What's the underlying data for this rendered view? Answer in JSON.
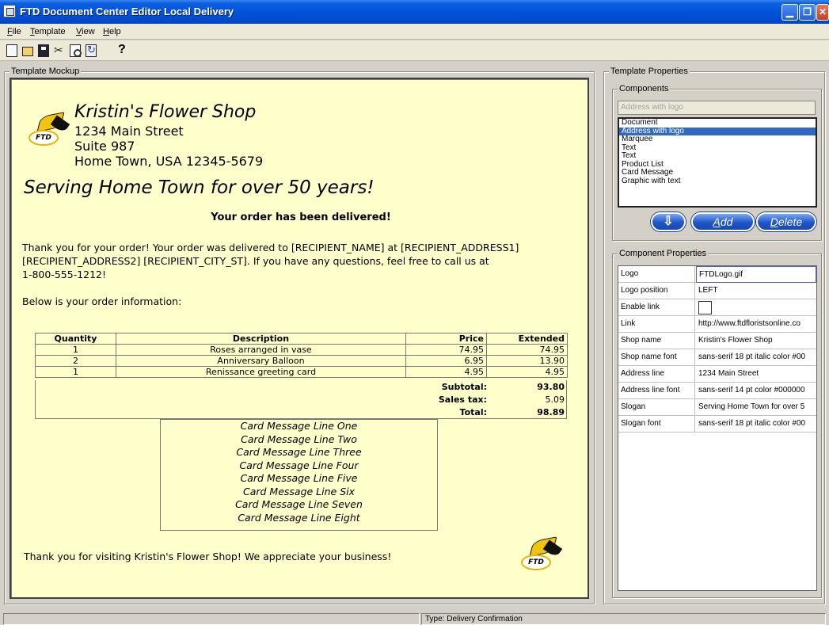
{
  "window": {
    "title": "FTD Document Center Editor  Local Delivery",
    "controls": {
      "minimize": "▁",
      "maximize": "❐",
      "close": "✕"
    }
  },
  "menu": [
    {
      "underline": "F",
      "rest": "ile"
    },
    {
      "underline": "T",
      "rest": "emplate"
    },
    {
      "underline": "V",
      "rest": "iew"
    },
    {
      "underline": "H",
      "rest": "elp"
    }
  ],
  "toolbar": {
    "icons": [
      "new-file-icon",
      "open-folder-icon",
      "save-icon",
      "cut-icon",
      "print-preview-icon",
      "refresh-icon",
      "help-icon"
    ]
  },
  "mockup": {
    "group_label": "Template Mockup",
    "shop_name": "Kristin's Flower Shop",
    "address_lines": [
      "1234 Main Street",
      "Suite 987",
      "Home Town, USA  12345-5679"
    ],
    "slogan": "Serving Home Town for over 50 years!",
    "marquee": "Your order has been delivered!",
    "logo_text": "FTD",
    "paragraph_lines": [
      "Thank you for your order! Your order was delivered to [RECIPIENT_NAME] at [RECIPIENT_ADDRESS1]",
      "[RECIPIENT_ADDRESS2] [RECIPIENT_CITY_ST]. If you have any questions, feel free to call us at",
      "1-800-555-1212!"
    ],
    "order_info_label": "Below is your order information:",
    "table": {
      "headers": [
        "Quantity",
        "Description",
        "Price",
        "Extended"
      ],
      "rows": [
        [
          "1",
          "Roses arranged in vase",
          "74.95",
          "74.95"
        ],
        [
          "2",
          "Anniversary Balloon",
          "6.95",
          "13.90"
        ],
        [
          "1",
          "Renissance greeting card",
          "4.95",
          "4.95"
        ]
      ],
      "subtotal_label": "Subtotal:",
      "subtotal": "93.80",
      "tax_label": "Sales tax:",
      "tax": "5.09",
      "total_label": "Total:",
      "total": "98.89"
    },
    "card_message": [
      "Card Message Line One",
      "Card Message Line Two",
      "Card Message Line Three",
      "Card Message Line Four",
      "Card Message Line Five",
      "Card Message Line Six",
      "Card Message Line Seven",
      "Card Message Line Eight"
    ],
    "closing": "Thank you for visiting Kristin's Flower Shop! We appreciate your business!"
  },
  "properties_panel": {
    "group_label": "Template Properties",
    "components_label": "Components",
    "combo_value": "Address with logo",
    "components": [
      "Document",
      "Address with logo",
      "Marquee",
      "Text",
      "Text",
      "Product List",
      "Card Message",
      "Graphic with text"
    ],
    "selected_index": 1,
    "buttons": {
      "move_down_icon": "⇩",
      "add_u": "A",
      "add_rest": "dd",
      "delete_u": "D",
      "delete_rest": "elete"
    },
    "component_properties_label": "Component Properties",
    "properties": [
      {
        "key": "Logo",
        "value": "FTDLogo.gif"
      },
      {
        "key": "Logo position",
        "value": "LEFT"
      },
      {
        "key": "Enable link",
        "value": ""
      },
      {
        "key": "Link",
        "value": "http://www.ftdfloristsonline.co"
      },
      {
        "key": "Shop name",
        "value": "Kristin's Flower Shop"
      },
      {
        "key": "Shop name font",
        "value": "sans-serif 18 pt italic color #00"
      },
      {
        "key": "Address line",
        "value": "1234 Main Street"
      },
      {
        "key": "Address line font",
        "value": "sans-serif 14 pt color #000000"
      },
      {
        "key": "Slogan",
        "value": "Serving Home Town for over 5"
      },
      {
        "key": "Slogan font",
        "value": "sans-serif 18 pt italic color #00"
      }
    ]
  },
  "status": {
    "type": "Type: Delivery Confirmation"
  }
}
